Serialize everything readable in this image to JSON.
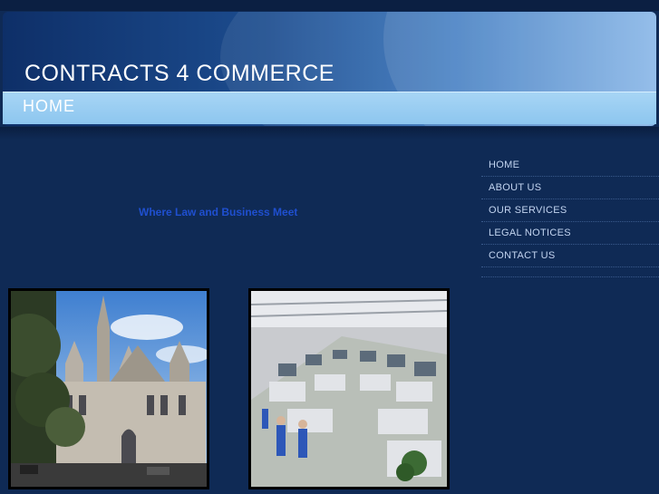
{
  "header": {
    "site_title": "CONTRACTS 4 COMMERCE",
    "page_label": "HOME"
  },
  "main": {
    "tagline": "Where Law and Business Meet"
  },
  "nav": {
    "items": [
      {
        "label": "HOME"
      },
      {
        "label": "ABOUT US"
      },
      {
        "label": "OUR SERVICES"
      },
      {
        "label": "LEGAL NOTICES"
      },
      {
        "label": "CONTACT US"
      }
    ]
  },
  "colors": {
    "background": "#0f2a55",
    "tagline": "#1f4fcf",
    "nav_text": "#c2d4f0",
    "banner_strip": "#8dc6ef"
  },
  "images": {
    "left": "courthouse-photo",
    "right": "factory-floor-photo"
  }
}
